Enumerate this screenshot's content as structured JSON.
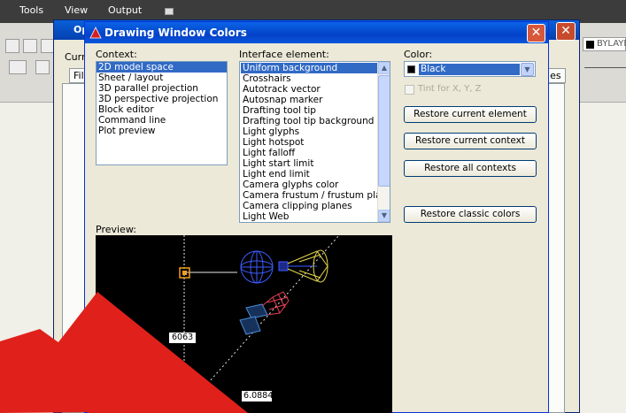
{
  "app_menu": [
    "Tools",
    "View",
    "Output"
  ],
  "app_status": {
    "bylayer": "BYLAYE"
  },
  "options_dialog": {
    "title": "Op",
    "current_label": "Curre",
    "tabs": [
      "File",
      "iles"
    ]
  },
  "dialog": {
    "title": "Drawing Window Colors",
    "close_label": "✕",
    "context_label": "Context:",
    "contexts": [
      "2D model space",
      "Sheet / layout",
      "3D parallel projection",
      "3D perspective projection",
      "Block editor",
      "Command line",
      "Plot preview"
    ],
    "interface_label": "Interface element:",
    "interface_elements": [
      "Uniform background",
      "Crosshairs",
      "Autotrack vector",
      "Autosnap marker",
      "Drafting tool tip",
      "Drafting tool tip background",
      "Light glyphs",
      "Light hotspot",
      "Light falloff",
      "Light start limit",
      "Light end limit",
      "Camera glyphs color",
      "Camera frustum / frustum plane",
      "Camera clipping planes",
      "Light Web"
    ],
    "color_label": "Color:",
    "color_value": "Black",
    "tint_label": "Tint for X, Y, Z",
    "buttons": {
      "restore_element": "Restore current element",
      "restore_context": "Restore current context",
      "restore_all": "Restore all contexts",
      "restore_classic": "Restore classic colors"
    },
    "preview_label": "Preview:",
    "preview_values": [
      "6063",
      "6.0884"
    ]
  },
  "colors": {
    "accent": "#316ac5",
    "titlebar": "#0a54d8",
    "preview_bg": "#000000",
    "arrow": "#e0211b"
  }
}
